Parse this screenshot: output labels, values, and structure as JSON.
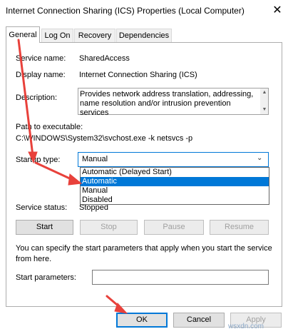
{
  "window": {
    "title": "Internet Connection Sharing (ICS) Properties (Local Computer)",
    "close_glyph": "✕"
  },
  "tabs": [
    {
      "label": "General",
      "active": true
    },
    {
      "label": "Log On",
      "active": false
    },
    {
      "label": "Recovery",
      "active": false
    },
    {
      "label": "Dependencies",
      "active": false
    }
  ],
  "general": {
    "service_name_label": "Service name:",
    "service_name_value": "SharedAccess",
    "display_name_label": "Display name:",
    "display_name_value": "Internet Connection Sharing (ICS)",
    "description_label": "Description:",
    "description_value": "Provides network address translation, addressing, name resolution and/or intrusion prevention services",
    "path_label": "Path to executable:",
    "path_value": "C:\\WINDOWS\\System32\\svchost.exe -k netsvcs -p",
    "startup_type_label": "Startup type:",
    "startup_type_value": "Manual",
    "startup_options": [
      "Automatic (Delayed Start)",
      "Automatic",
      "Manual",
      "Disabled"
    ],
    "startup_highlighted": "Automatic",
    "service_status_label": "Service status:",
    "service_status_value": "Stopped",
    "buttons": {
      "start": "Start",
      "stop": "Stop",
      "pause": "Pause",
      "resume": "Resume"
    },
    "start_params_help": "You can specify the start parameters that apply when you start the service from here.",
    "start_params_label": "Start parameters:",
    "start_params_value": ""
  },
  "footer": {
    "ok": "OK",
    "cancel": "Cancel",
    "apply": "Apply"
  },
  "watermark": "wsxdn.com",
  "colors": {
    "accent": "#0078d7",
    "annotation_arrow": "#e8413b"
  }
}
